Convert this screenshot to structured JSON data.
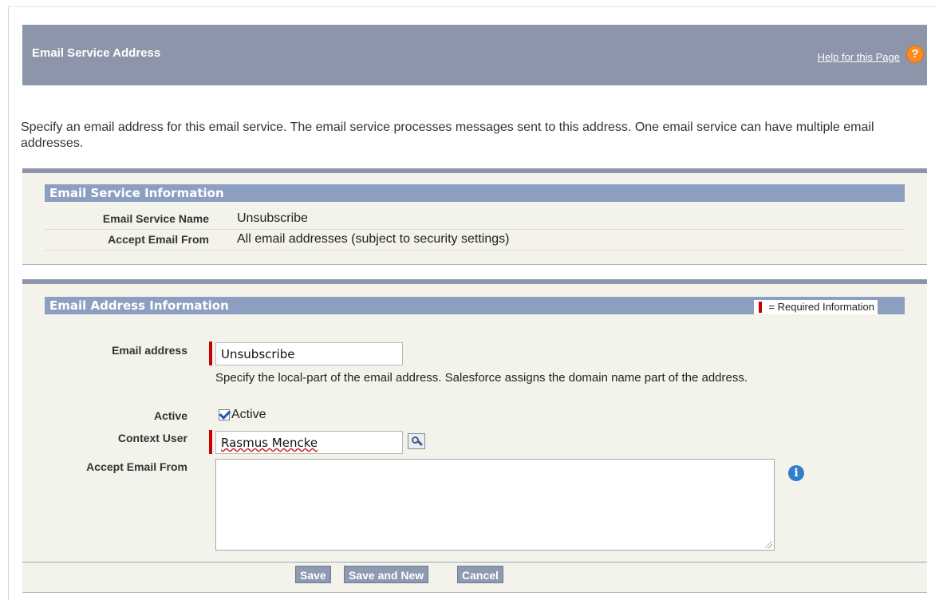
{
  "header": {
    "title": "Email Service Address",
    "help_link": "Help for this Page",
    "help_icon": "?"
  },
  "intro": "Specify an email address for this email service. The email service processes messages sent to this address. One email service can have multiple email addresses.",
  "service_info": {
    "title": "Email Service Information",
    "rows": [
      {
        "label": "Email Service Name",
        "value": "Unsubscribe"
      },
      {
        "label": "Accept Email From",
        "value": "All email addresses (subject to security settings)"
      }
    ]
  },
  "address_info": {
    "title": "Email Address Information",
    "required_legend": "= Required Information",
    "email_label": "Email address",
    "email_value": "Unsubscribe",
    "email_help": "Specify the local-part of the email address. Salesforce assigns the domain name part of the address.",
    "active_label": "Active",
    "active_checkbox_label": "Active",
    "active_checked": true,
    "context_user_label": "Context User",
    "context_user_value": "Rasmus Mencke",
    "accept_from_label": "Accept Email From",
    "accept_from_value": "",
    "info_icon": "i"
  },
  "buttons": {
    "save": "Save",
    "save_new": "Save and New",
    "cancel": "Cancel"
  },
  "colors": {
    "header": "#8c95a9",
    "section_bar": "#8c9fc0",
    "required": "#cc0000",
    "help_icon": "#ff8a1f"
  }
}
